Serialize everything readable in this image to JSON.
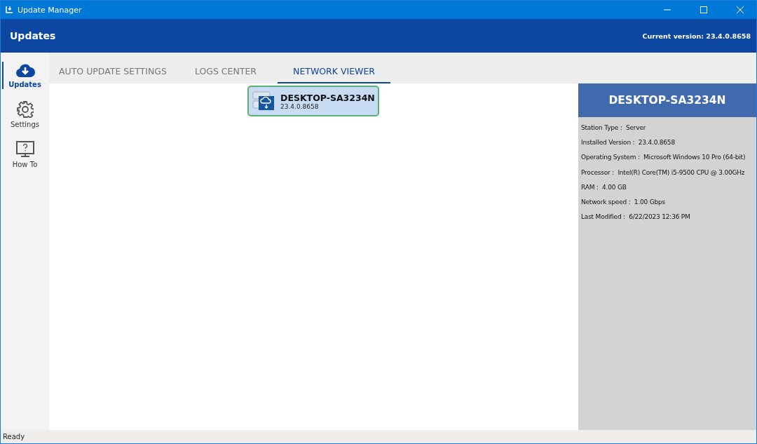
{
  "window": {
    "title": "Update Manager"
  },
  "header": {
    "title": "Updates",
    "current_version": "Current version: 23.4.0.8658"
  },
  "sidebar": {
    "items": [
      {
        "label": "Updates",
        "kind": "cloud",
        "selected": true
      },
      {
        "label": "Settings",
        "kind": "gear",
        "selected": false
      },
      {
        "label": "How To",
        "kind": "help",
        "selected": false
      }
    ]
  },
  "tabs": [
    {
      "label": "AUTO UPDATE SETTINGS",
      "selected": false
    },
    {
      "label": "LOGS CENTER",
      "selected": false
    },
    {
      "label": "NETWORK VIEWER",
      "selected": true
    }
  ],
  "network": {
    "nodes": [
      {
        "name": "DESKTOP-SA3234N",
        "version": "23.4.0.8658",
        "selected": true
      }
    ]
  },
  "details": {
    "title": "DESKTOP-SA3234N",
    "fields": [
      {
        "label": "Station Type :",
        "value": "Server"
      },
      {
        "label": "Installed Version :",
        "value": "23.4.0.8658"
      },
      {
        "label": "Operating System :",
        "value": "Microsoft Windows 10 Pro (64-bit)"
      },
      {
        "label": "Processor :",
        "value": "Intel(R) Core(TM) i5-9500 CPU @ 3.00GHz"
      },
      {
        "label": "RAM :",
        "value": "4.00 GB"
      },
      {
        "label": "Network speed :",
        "value": "1.00 Gbps"
      },
      {
        "label": "Last Modified :",
        "value": "6/22/2023 12:36 PM"
      }
    ]
  },
  "status_bar": {
    "text": "Ready"
  }
}
